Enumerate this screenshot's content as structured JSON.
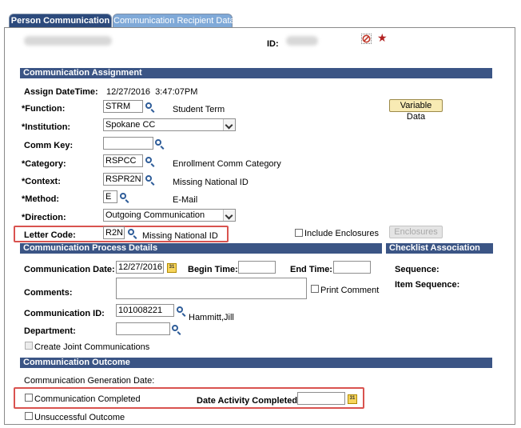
{
  "tabs": [
    {
      "label": "Person Communication",
      "active": true
    },
    {
      "label": "Communication Recipient Data",
      "active": false
    }
  ],
  "header": {
    "id_label": "ID:",
    "star": "★"
  },
  "assignment": {
    "section_title": "Communication Assignment",
    "assign_datetime_label": "Assign DateTime:",
    "assign_datetime_value": "12/27/2016  3:47:07PM",
    "function_label": "*Function:",
    "function_value": "STRM",
    "function_desc": "Student Term",
    "variable_data_button": "Variable Data",
    "institution_label": "*Institution:",
    "institution_value": "Spokane CC",
    "comm_key_label": "Comm Key:",
    "comm_key_value": "",
    "category_label": "*Category:",
    "category_value": "RSPCC",
    "category_desc": "Enrollment Comm Category",
    "context_label": "*Context:",
    "context_value": "RSPR2N",
    "context_desc": "Missing National ID",
    "method_label": "*Method:",
    "method_value": "E",
    "method_desc": "E-Mail",
    "direction_label": "*Direction:",
    "direction_value": "Outgoing Communication",
    "letter_code_label": "Letter Code:",
    "letter_code_value": "R2N",
    "letter_code_desc": "Missing National ID",
    "include_enclosures_label": "Include Enclosures",
    "enclosures_button": "Enclosures"
  },
  "process": {
    "section_title": "Communication Process Details",
    "comm_date_label": "Communication Date:",
    "comm_date_value": "12/27/2016",
    "begin_time_label": "Begin Time:",
    "end_time_label": "End Time:",
    "comments_label": "Comments:",
    "print_comment_label": "Print Comment",
    "comm_id_label": "Communication ID:",
    "comm_id_value": "101008221",
    "comm_id_name": "Hammitt,Jill",
    "department_label": "Department:",
    "joint_label": "Create Joint Communications"
  },
  "checklist": {
    "section_title": "Checklist Association",
    "sequence_label": "Sequence:",
    "item_sequence_label": "Item Sequence:"
  },
  "outcome": {
    "section_title": "Communication Outcome",
    "gen_date_label": "Communication Generation Date:",
    "completed_label": "Communication Completed",
    "date_completed_label": "Date Activity Completed:",
    "unsuccessful_label": "Unsuccessful Outcome"
  },
  "colors": {
    "section_bar": "#3b5585",
    "highlight": "#d9534f",
    "accent_star": "#b22222"
  }
}
